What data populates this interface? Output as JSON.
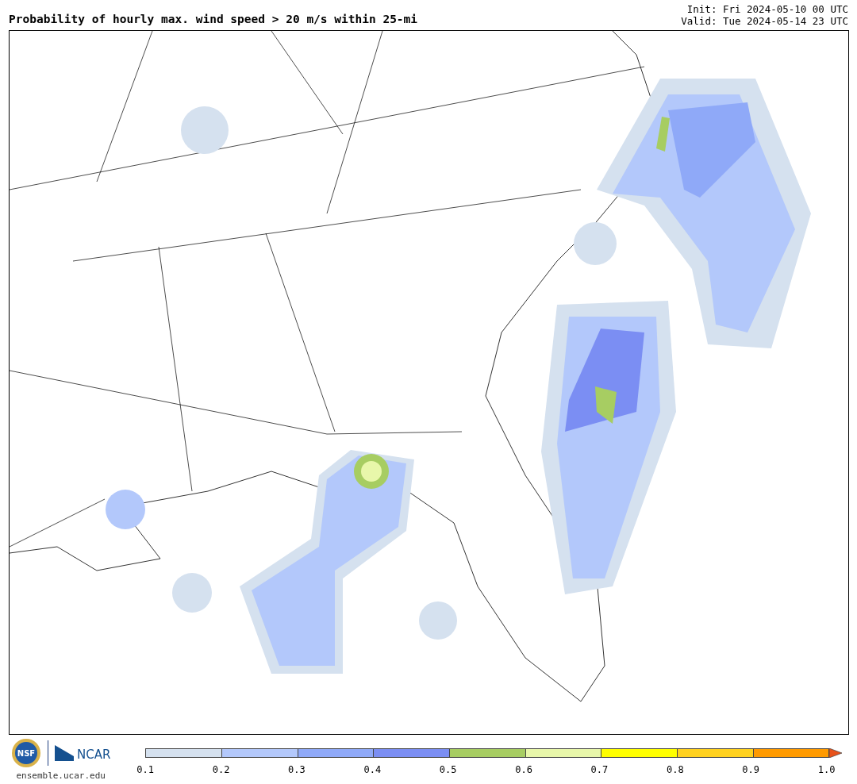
{
  "title": "Probability of hourly max. wind speed > 20 m/s within 25-mi",
  "init": "Init: Fri 2024-05-10 00 UTC",
  "valid": "Valid: Tue 2024-05-14 23 UTC",
  "logos": {
    "nsf": "NSF",
    "ncar": "NCAR"
  },
  "site": "ensemble.ucar.edu",
  "colorbar": {
    "bins": [
      {
        "color": "#d5e1ef"
      },
      {
        "color": "#b3c8fb"
      },
      {
        "color": "#8fa9f8"
      },
      {
        "color": "#7b8ef3"
      },
      {
        "color": "#a7cd62"
      },
      {
        "color": "#e8f7aa"
      },
      {
        "color": "#ffff00"
      },
      {
        "color": "#ffd11f"
      },
      {
        "color": "#ff9a00"
      }
    ],
    "over": {
      "color": "#e8521b"
    },
    "ticks": [
      "0.1",
      "0.2",
      "0.3",
      "0.4",
      "0.5",
      "0.6",
      "0.7",
      "0.8",
      "0.9",
      "1.0"
    ]
  }
}
